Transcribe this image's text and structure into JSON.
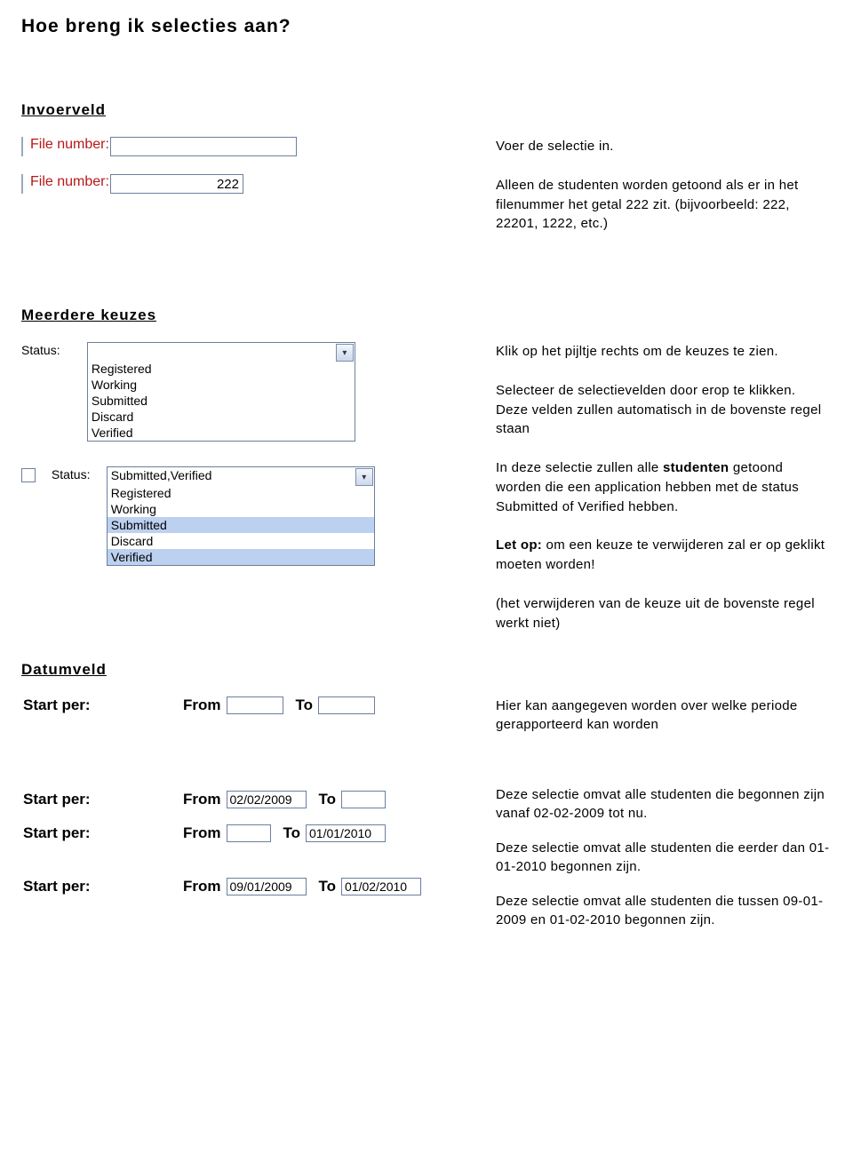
{
  "title": "Hoe breng ik selecties aan?",
  "section_invoerveld": {
    "heading": "Invoerveld",
    "field_label": "File number:",
    "example2_value": "222",
    "desc1": "Voer de selectie in.",
    "desc2": "Alleen de studenten worden getoond als er in het filenummer het getal 222 zit. (bijvoorbeeld: 222, 22201, 1222, etc.)"
  },
  "section_keuzes": {
    "heading": "Meerdere keuzes",
    "status_label": "Status:",
    "options": [
      "Registered",
      "Working",
      "Submitted",
      "Discard",
      "Verified"
    ],
    "selected_display": "Submitted,Verified",
    "desc1": "Klik op het pijltje rechts om de keuzes te zien.",
    "desc2": "Selecteer de selectievelden door erop te klikken. Deze velden zullen automatisch in de bovenste regel staan",
    "desc3a": "In deze selectie zullen alle ",
    "desc3b": "studenten",
    "desc3c": " getoond worden die een application hebben met de status Submitted of Verified hebben.",
    "desc4a": "Let op:",
    "desc4b": " om een keuze te verwijderen zal er op geklikt moeten worden!",
    "desc5": "(het verwijderen van de keuze uit de bovenste regel werkt niet)"
  },
  "section_datum": {
    "heading": "Datumveld",
    "start_label": "Start per:",
    "from_label": "From",
    "to_label": "To",
    "rows": [
      {
        "from": "",
        "to": ""
      },
      {
        "from": "02/02/2009",
        "to": ""
      },
      {
        "from": "",
        "to": "01/01/2010"
      },
      {
        "from": "09/01/2009",
        "to": "01/02/2010"
      }
    ],
    "side1": "Hier kan aangegeven worden over welke periode gerapporteerd kan worden",
    "side2": "Deze selectie omvat alle studenten die begonnen zijn vanaf 02-02-2009 tot nu.",
    "side3": "Deze selectie omvat alle studenten die eerder dan 01-01-2010 begonnen zijn.",
    "side4": "Deze selectie omvat alle studenten die tussen 09-01-2009 en 01-02-2010 begonnen zijn."
  }
}
